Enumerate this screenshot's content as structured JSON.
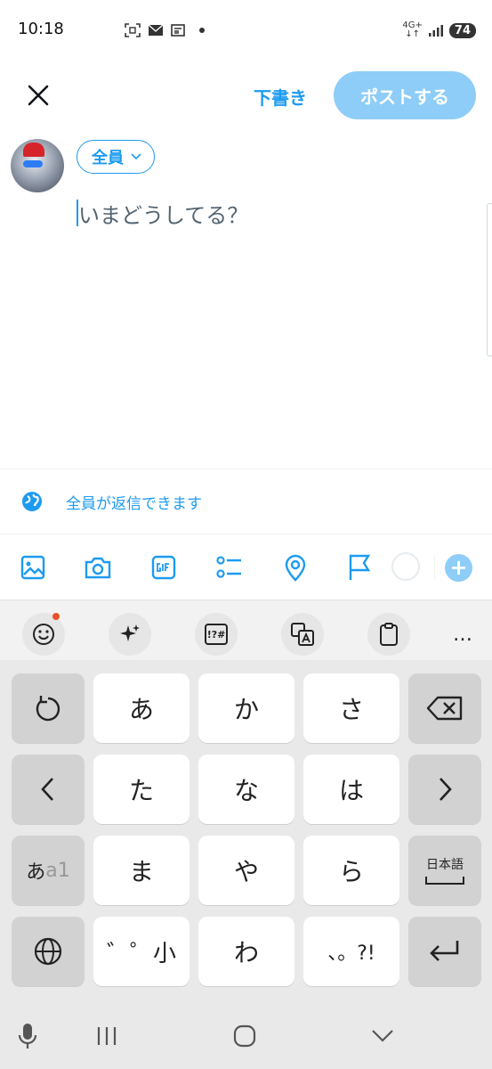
{
  "status_bar": {
    "time": "10:18",
    "net_top": "4G+",
    "net_bottom": "↓↑",
    "battery": "74"
  },
  "header": {
    "drafts_label": "下書き",
    "post_label": "ポストする"
  },
  "compose": {
    "audience_label": "全員",
    "placeholder": "いまどうしてる？"
  },
  "reply_setting": {
    "label": "全員が返信できます"
  },
  "toolbar": {
    "plus": "+"
  },
  "keyboard": {
    "tools": [
      "emoji-icon",
      "sparkle-icon",
      "symbols-icon",
      "translate-icon",
      "clipboard-icon",
      "more-icon"
    ],
    "symbols_label": "!?#",
    "more_label": "…",
    "rows": [
      [
        "あ",
        "か",
        "さ"
      ],
      [
        "た",
        "な",
        "は"
      ],
      [
        "ま",
        "や",
        "ら"
      ],
      [
        "゛゜小",
        "わ",
        "、。?!"
      ]
    ],
    "mode_label_a": "あ",
    "mode_label_b": "a1",
    "lang_label": "日本語"
  },
  "colors": {
    "accent": "#1d9bf0",
    "post_disabled": "#8ecdf7"
  }
}
